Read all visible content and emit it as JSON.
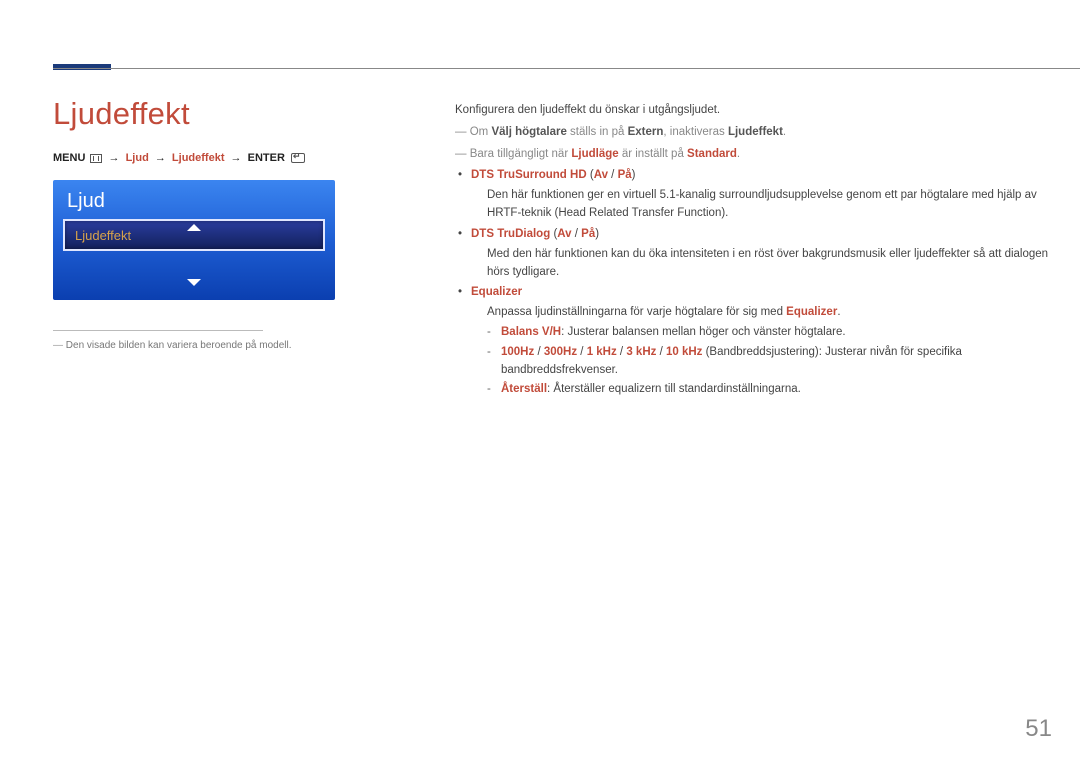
{
  "page": {
    "title": "Ljudeffekt",
    "number": "51"
  },
  "breadcrumb": {
    "menu": "MENU",
    "seg1": "Ljud",
    "seg2": "Ljudeffekt",
    "enter": "ENTER"
  },
  "panel": {
    "header": "Ljud",
    "selected": "Ljudeffekt",
    "note": "Den visade bilden kan variera beroende på modell."
  },
  "content": {
    "intro": "Konfigurera den ljudeffekt du önskar i utgångsljudet.",
    "note1_pre": "Om ",
    "note1_b1": "Välj högtalare",
    "note1_mid": " ställs in på ",
    "note1_b2": "Extern",
    "note1_mid2": ", inaktiveras ",
    "note1_b3": "Ljudeffekt",
    "note1_end": ".",
    "note2_pre": "Bara tillgängligt när ",
    "note2_a1": "Ljudläge",
    "note2_mid": " är inställt på ",
    "note2_a2": "Standard",
    "note2_end": ".",
    "items": [
      {
        "head": "DTS TruSurround HD",
        "opts": [
          "Av",
          "På"
        ],
        "body": "Den här funktionen ger en virtuell 5.1-kanalig surroundljudsupplevelse genom ett par högtalare med hjälp av HRTF-teknik (Head Related Transfer Function)."
      },
      {
        "head": "DTS TruDialog",
        "opts": [
          "Av",
          "På"
        ],
        "body": "Med den här funktionen kan du öka intensiteten i en röst över bakgrundsmusik eller ljudeffekter så att dialogen hörs tydligare."
      },
      {
        "head": "Equalizer",
        "opts": [],
        "body_pre": "Anpassa ljudinställningarna för varje högtalare för sig med ",
        "body_accent": "Equalizer",
        "body_end": ".",
        "sub": [
          {
            "accent": "Balans V/H",
            "text": ": Justerar balansen mellan höger och vänster högtalare."
          },
          {
            "accent_list": [
              "100Hz",
              "300Hz",
              "1 kHz",
              "3 kHz",
              "10 kHz"
            ],
            "text_pre": " (Bandbreddsjustering): Justerar nivån för specifika bandbreddsfrekvenser."
          },
          {
            "accent": "Återställ",
            "text": ": Återställer equalizern till standardinställningarna."
          }
        ]
      }
    ]
  }
}
